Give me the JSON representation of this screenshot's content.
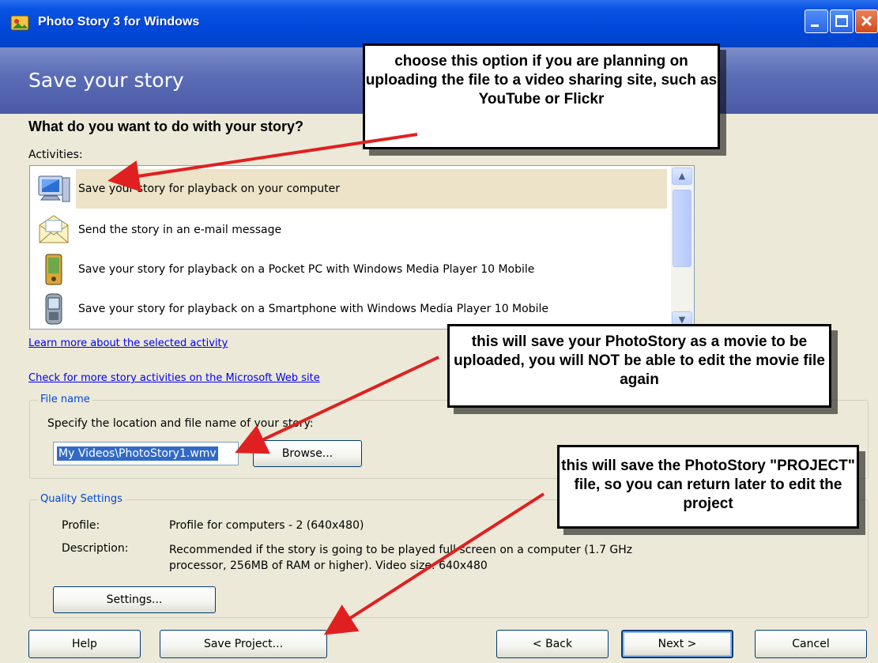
{
  "window": {
    "title": "Photo Story 3 for Windows",
    "header_title": "Save your story"
  },
  "main": {
    "question": "What do you want to do with your story?",
    "activities_label": "Activities:",
    "activities": [
      {
        "label": "Save your story for playback on your computer",
        "icon": "computer-icon",
        "selected": true
      },
      {
        "label": "Send the story in an e-mail message",
        "icon": "email-envelope-icon",
        "selected": false
      },
      {
        "label": "Save your story for playback on a Pocket PC with Windows Media Player 10 Mobile",
        "icon": "pocket-pc-icon",
        "selected": false
      },
      {
        "label": "Save your story for playback on a Smartphone with Windows Media Player 10 Mobile",
        "icon": "smartphone-icon",
        "selected": false
      }
    ],
    "learn_more_link": "Learn more about the selected activity",
    "check_more_link": "Check for more story activities on the Microsoft Web site"
  },
  "file_name": {
    "legend": "File name",
    "specify_label": "Specify the location and file name of your story:",
    "path_value": "My Videos\\PhotoStory1.wmv",
    "browse_label": "Browse..."
  },
  "quality": {
    "legend": "Quality Settings",
    "profile_label": "Profile:",
    "profile_value": "Profile for computers - 2 (640x480)",
    "description_label": "Description:",
    "description_value": "Recommended if the story is going to be played full screen on a computer (1.7 GHz processor, 256MB of RAM or higher). Video size: 640x480",
    "settings_label": "Settings..."
  },
  "footer": {
    "help_label": "Help",
    "save_project_label": "Save Project...",
    "back_label": "< Back",
    "next_label": "Next >",
    "cancel_label": "Cancel"
  },
  "callouts": {
    "callout_1": "choose this option if you are planning on uploading the file to a video sharing site, such as YouTube or Flickr",
    "callout_2": "this will save your PhotoStory as a movie to be uploaded, you will NOT be able to edit the movie file again",
    "callout_3": "this will save the PhotoStory \"PROJECT\" file, so you can return later to edit the project"
  },
  "colors": {
    "titlebar": "#0a54e3",
    "header": "#5c6eb7",
    "window_bg": "#ece9d8",
    "selection": "#316ac5",
    "link": "#0000ee",
    "arrow": "#e02020"
  }
}
